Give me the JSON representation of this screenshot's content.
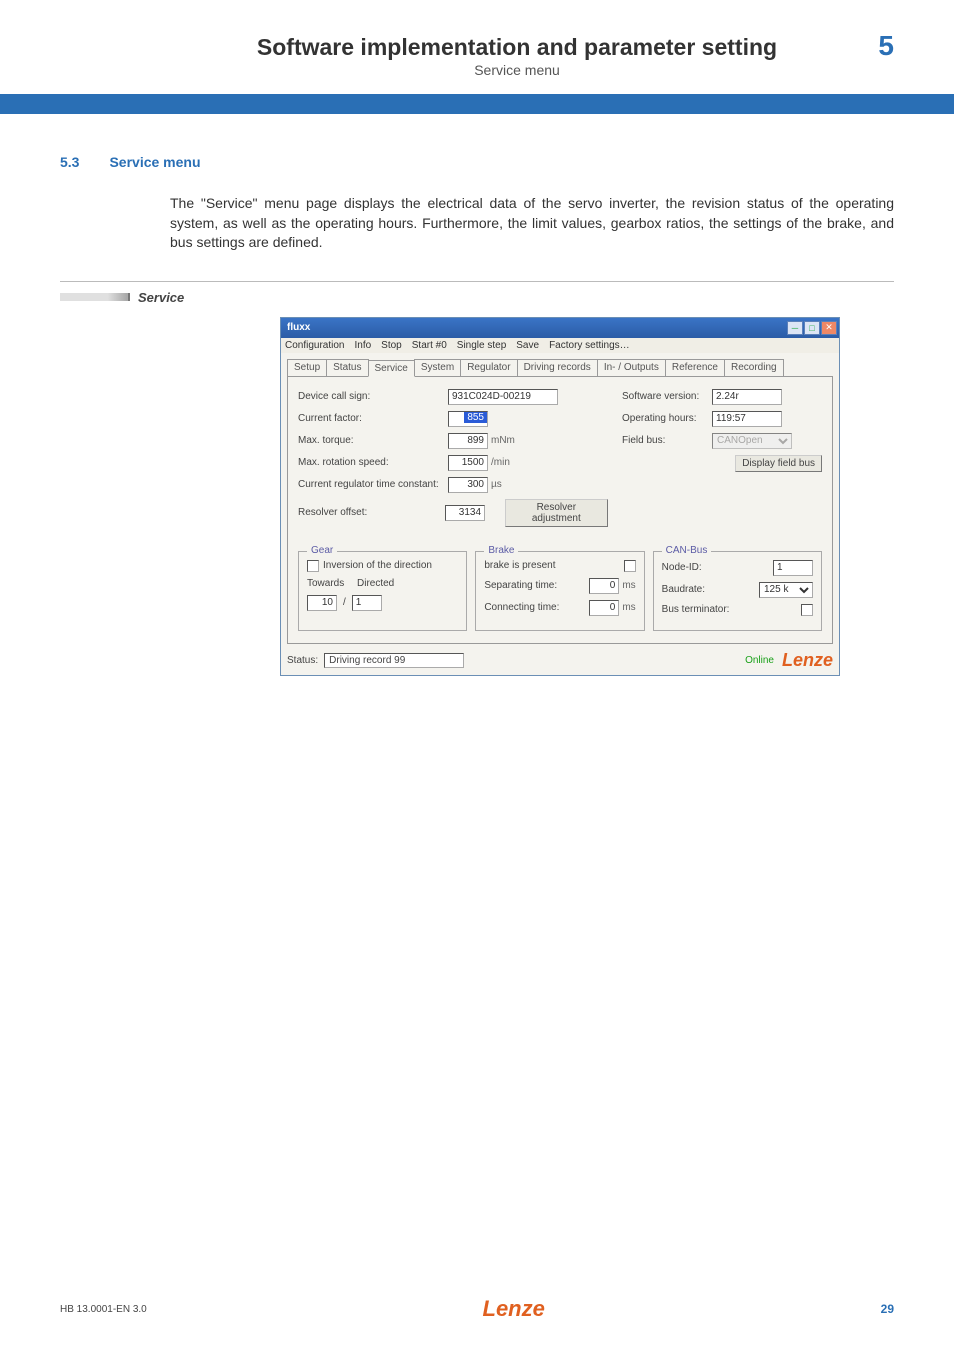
{
  "header": {
    "title": "Software implementation and parameter setting",
    "subtitle": "Service menu",
    "chapter_num": "5"
  },
  "section": {
    "num": "5.3",
    "title": "Service menu"
  },
  "body_para": "The \"Service\" menu page displays the electrical data of the servo inverter, the revision status of the operating system, as well as the operating hours. Furthermore, the limit values, gearbox ratios, the settings of the brake, and bus settings are defined.",
  "service_heading": "Service",
  "window": {
    "title": "fluxx",
    "menus": [
      "Configuration",
      "Info",
      "Stop",
      "Start #0",
      "Single step",
      "Save",
      "Factory settings…"
    ],
    "tabs": [
      "Setup",
      "Status",
      "Service",
      "System",
      "Regulator",
      "Driving records",
      "In- / Outputs",
      "Reference",
      "Recording"
    ],
    "active_tab": "Service",
    "left_fields": {
      "device_call_sign": {
        "label": "Device call sign:",
        "value": "931C024D-00219"
      },
      "current_factor": {
        "label": "Current factor:",
        "value": "855"
      },
      "max_torque": {
        "label": "Max. torque:",
        "value": "899",
        "unit": "mNm"
      },
      "max_rot_speed": {
        "label": "Max. rotation speed:",
        "value": "1500",
        "unit": "/min"
      },
      "cur_reg_tc": {
        "label": "Current regulator time constant:",
        "value": "300",
        "unit": "µs"
      },
      "resolver": {
        "label": "Resolver offset:",
        "value": "3134",
        "btn": "Resolver adjustment"
      }
    },
    "right_fields": {
      "sw_version": {
        "label": "Software version:",
        "value": "2.24r"
      },
      "op_hours": {
        "label": "Operating hours:",
        "value": "119:57"
      },
      "field_bus": {
        "label": "Field bus:",
        "value": "CANOpen",
        "btn": "Display field bus"
      }
    },
    "gear": {
      "title": "Gear",
      "inversion_label": "Inversion of the direction",
      "towards": "Towards",
      "directed": "Directed",
      "towards_val": "10",
      "directed_val": "1"
    },
    "brake": {
      "title": "Brake",
      "present_label": "brake is present",
      "sep_label": "Separating time:",
      "sep_val": "0",
      "sep_unit": "ms",
      "con_label": "Connecting time:",
      "con_val": "0",
      "con_unit": "ms"
    },
    "canbus": {
      "title": "CAN-Bus",
      "node_label": "Node-ID:",
      "node_val": "1",
      "baud_label": "Baudrate:",
      "baud_val": "125 k",
      "term_label": "Bus terminator:"
    },
    "status": {
      "label": "Status:",
      "value": "Driving record 99",
      "online": "Online",
      "logo": "Lenze"
    }
  },
  "footer": {
    "left": "HB 13.0001-EN   3.0",
    "logo": "Lenze",
    "page": "29"
  }
}
